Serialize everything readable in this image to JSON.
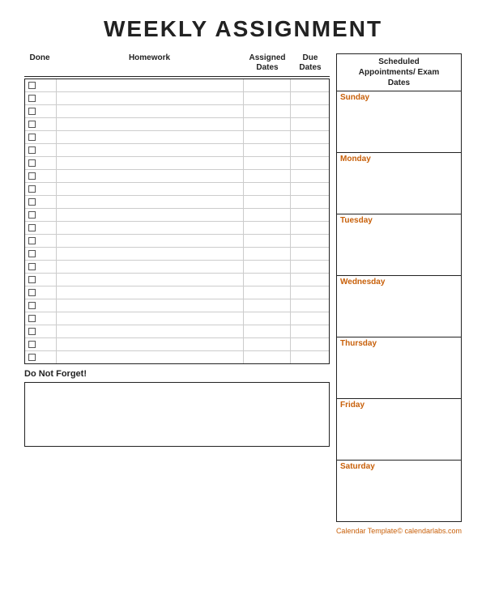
{
  "title": "WEEKLY ASSIGNMENT",
  "columns": {
    "done": "Done",
    "homework": "Homework",
    "assigned_dates": "Assigned\nDates",
    "due_dates": "Due\nDates",
    "scheduled": "Scheduled\nAppointments/ Exam\nDates"
  },
  "rows_count": 22,
  "do_not_forget_label": "Do Not Forget!",
  "days": [
    {
      "label": "Sunday",
      "content": ""
    },
    {
      "label": "Monday",
      "content": ""
    },
    {
      "label": "Tuesday",
      "content": ""
    },
    {
      "label": "Wednesday",
      "content": ""
    },
    {
      "label": "Thursday",
      "content": ""
    },
    {
      "label": "Friday",
      "content": ""
    },
    {
      "label": "Saturday",
      "content": ""
    }
  ],
  "footer": "Calendar Template© calendarlabs.com"
}
